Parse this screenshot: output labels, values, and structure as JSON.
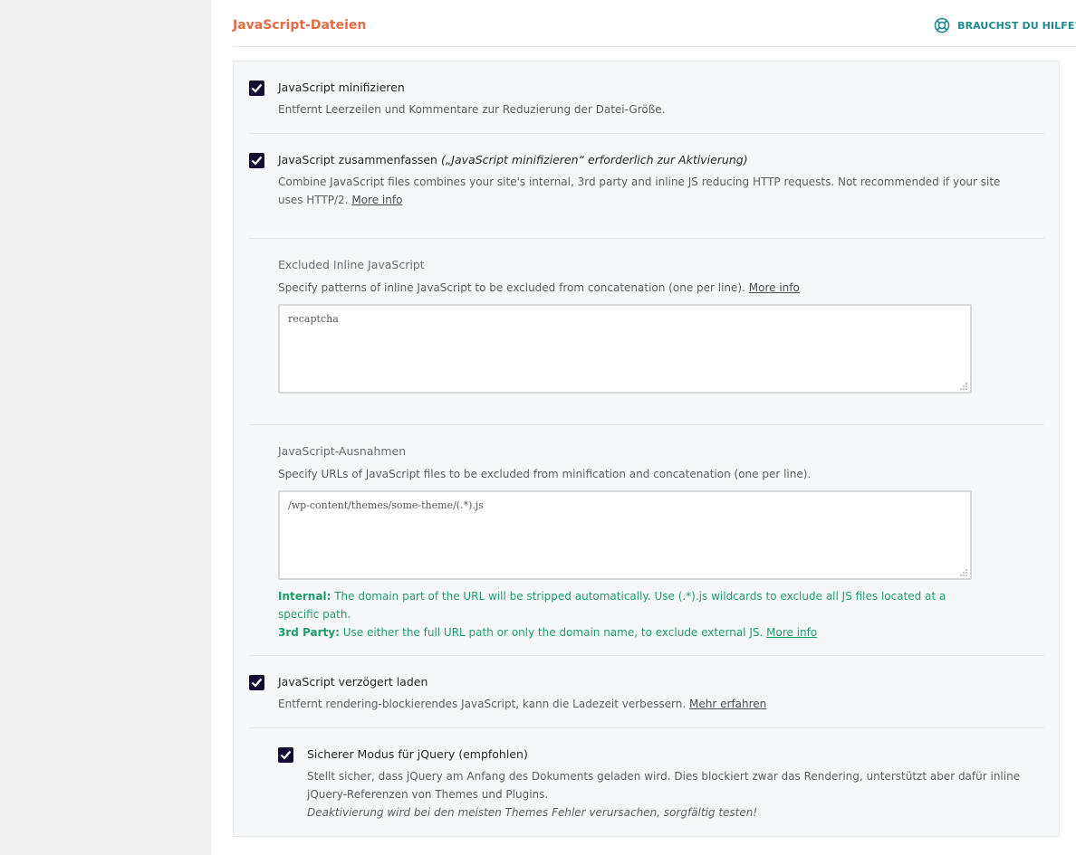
{
  "section": {
    "title": "JavaScript-Dateien",
    "help_label": "BRAUCHST DU HILFE?"
  },
  "options": {
    "minify": {
      "label": "JavaScript minifizieren",
      "description": "Entfernt Leerzeilen und Kommentare zur Reduzierung der Datei-Größe.",
      "checked": true
    },
    "combine": {
      "label": "JavaScript zusammenfassen",
      "label_note": "(„JavaScript minifizieren“ erforderlich zur Aktivierung)",
      "description": "Combine JavaScript files combines your site's internal, 3rd party and inline JS reducing HTTP requests. Not recommended if your site uses HTTP/2.",
      "more_info": "More info",
      "checked": true
    },
    "excluded_inline": {
      "title": "Excluded Inline JavaScript",
      "description": "Specify patterns of inline JavaScript to be excluded from concatenation (one per line).",
      "more_info": "More info",
      "value": "recaptcha"
    },
    "exclusions": {
      "title": "JavaScript-Ausnahmen",
      "description": "Specify URLs of JavaScript files to be excluded from minification and concatenation (one per line).",
      "value": "/wp-content/themes/some-theme/(.*).js",
      "internal_label": "Internal:",
      "internal_text": "The domain part of the URL will be stripped automatically. Use (.*).js wildcards to exclude all JS files located at a specific path.",
      "third_party_label": "3rd Party:",
      "third_party_text": "Use either the full URL path or only the domain name, to exclude external JS.",
      "more_info": "More info"
    },
    "defer": {
      "label": "JavaScript verzögert laden",
      "description": "Entfernt rendering-blockierendes JavaScript, kann die Ladezeit verbessern.",
      "more_info": "Mehr erfahren",
      "checked": true
    },
    "safe_mode": {
      "label": "Sicherer Modus für jQuery (empfohlen)",
      "description": "Stellt sicher, dass jQuery am Anfang des Dokuments geladen wird. Dies blockiert zwar das Rendering, unterstützt aber dafür inline jQuery-Referenzen von Themes und Plugins.",
      "warning": "Deaktivierung wird bei den meisten Themes Fehler verursachen, sorgfältig testen!",
      "checked": true
    }
  },
  "colors": {
    "accent": "#e96b44",
    "help": "#1f8a8f",
    "checkbox": "#150a2f",
    "note": "#1f9e6a"
  },
  "icons": {
    "help": "lifebuoy-icon",
    "check": "checkmark-icon",
    "resize": "resize-grip-icon"
  }
}
